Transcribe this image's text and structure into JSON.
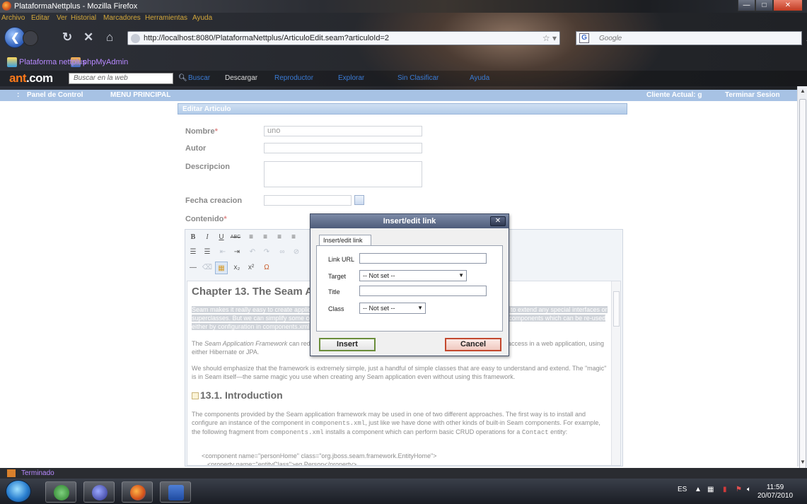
{
  "window": {
    "title": "PlataformaNettplus - Mozilla Firefox",
    "min": "—",
    "max": "□",
    "close": "✕"
  },
  "menu": [
    "Archivo",
    "Editar",
    "Ver",
    "Historial",
    "Marcadores",
    "Herramientas",
    "Ayuda"
  ],
  "nav": {
    "url": "http://localhost:8080/PlataformaNettplus/ArticuloEdit.seam?articuloId=2",
    "search_placeholder": "Google"
  },
  "bookmarks": [
    "Plataforma nettplus",
    "phpMyAdmin"
  ],
  "ant_toolbar": {
    "logo_ant": "ant",
    "logo_com": ".com",
    "search_placeholder": "Buscar en la web",
    "items": [
      "Buscar",
      "Descargar",
      "Reproductor",
      "Explorar",
      "Sin Clasificar",
      "Ayuda"
    ]
  },
  "app_nav": {
    "left": [
      ":",
      "Panel de Control",
      "MENU PRINCIPAL"
    ],
    "client": "Cliente Actual: g",
    "logout": "Terminar Sesion"
  },
  "panel": {
    "header": "Editar Articulo",
    "fields": {
      "nombre_label": "Nombre",
      "nombre_value": "uno",
      "autor_label": "Autor",
      "descripcion_label": "Descripcion",
      "fecha_label": "Fecha creacion",
      "contenido_label": "Contenido",
      "required_mark": "*"
    }
  },
  "editor": {
    "toolbar_row1": [
      "B",
      "I",
      "U",
      "ABC",
      "≡",
      "≡",
      "≡",
      "≡"
    ],
    "toolbar_row2": [
      "☰",
      "☰",
      "⇤",
      "⇥",
      "↶",
      "↷",
      "∞",
      "⊘"
    ],
    "toolbar_row3": [
      "—",
      "⌫",
      "▦",
      "x₂",
      "x²",
      "Ω"
    ],
    "doc": {
      "h1": "Chapter 13. The Seam Application Framework",
      "p1": "Seam makes it really easy to create applications by writing plain Java classes with annotations, which don't need to extend any special interfaces or superclasses. But we can simplify some common programming tasks even further, by providing a set of pre-built components which can be re-used either by configuration in components.xml (for very simple cases) or by extension.",
      "p2_pre": "The ",
      "p2_em": "Seam Application Framework",
      "p2_post": " can reduce the amount of code you need to write when doing basic database access in a web application, using either Hibernate or JPA.",
      "p3": "We should emphasize that the framework is extremely simple, just a handful of simple classes that are easy to understand and extend. The \"magic\" is in Seam itself—the same magic you use when creating any Seam application even without using this framework.",
      "h2": "13.1. Introduction",
      "p4_a": "The components provided by the Seam application framework may be used in one of two different approaches. The first way is to install and configure an instance of the component in ",
      "p4_code1": "components.xml",
      "p4_b": ", just like we have done with other kinds of built-in Seam components. For example, the following fragment from ",
      "p4_code2": "components.xml",
      "p4_c": " installs a component which can perform basic CRUD operations for a ",
      "p4_code3": "Contact",
      "p4_d": " entity:",
      "code1": "<component name=\"personHome\" class=\"org.jboss.seam.framework.EntityHome\">",
      "code2": "<property name=\"entityClass\">eg.Person</property>"
    }
  },
  "dialog": {
    "title": "Insert/edit link",
    "tab": "Insert/edit link",
    "link_url_label": "Link URL",
    "target_label": "Target",
    "target_value": "-- Not set --",
    "title_label": "Title",
    "class_label": "Class",
    "class_value": "-- Not set --",
    "insert": "Insert",
    "cancel": "Cancel"
  },
  "status": {
    "text": "Terminado"
  },
  "tray": {
    "lang": "ES",
    "time": "11:59",
    "date": "20/07/2010"
  },
  "colors": {
    "app_nav": "#a7c2e4",
    "insert_border": "#6a8d3a",
    "cancel_border": "#c3482e",
    "menu_text": "#d4a83b"
  }
}
